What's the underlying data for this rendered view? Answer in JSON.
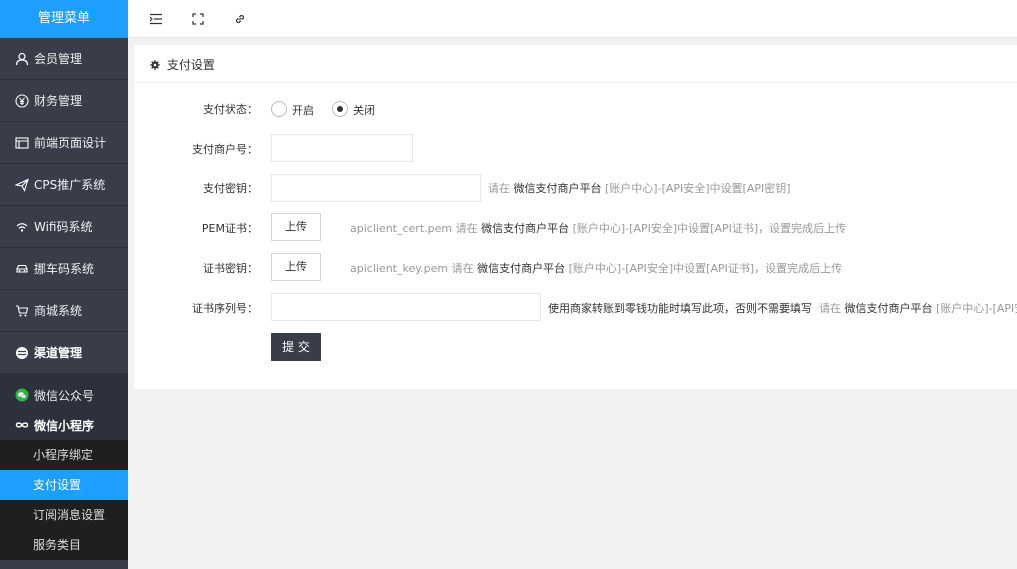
{
  "sidebar": {
    "header": "管理菜单",
    "items": [
      {
        "label": "会员管理",
        "icon": "user-icon"
      },
      {
        "label": "财务管理",
        "icon": "yen-icon"
      },
      {
        "label": "前端页面设计",
        "icon": "layout-icon"
      },
      {
        "label": "CPS推广系统",
        "icon": "send-icon"
      },
      {
        "label": "Wifi码系统",
        "icon": "wifi-icon"
      },
      {
        "label": "挪车码系统",
        "icon": "car-icon"
      },
      {
        "label": "商城系统",
        "icon": "cart-icon"
      },
      {
        "label": "渠道管理",
        "icon": "channel-icon"
      }
    ],
    "group": [
      {
        "label": "微信公众号",
        "icon": "wechat-icon"
      },
      {
        "label": "微信小程序",
        "icon": "miniprogram-icon"
      }
    ],
    "sub_items": [
      {
        "label": "小程序绑定"
      },
      {
        "label": "支付设置"
      },
      {
        "label": "订阅消息设置"
      },
      {
        "label": "服务类目"
      }
    ],
    "active_sub": "支付设置"
  },
  "toolbar": {
    "icons": [
      "menu-toggle-icon",
      "fullscreen-icon",
      "link-icon"
    ]
  },
  "panel": {
    "title": "支付设置",
    "form": {
      "status_label": "支付状态：",
      "status_options": [
        "开启",
        "关闭"
      ],
      "status_selected": "关闭",
      "merchant_label": "支付商户号：",
      "merchant_value": "",
      "key_label": "支付密钥：",
      "key_value": "",
      "key_hint_pre": "请在",
      "key_hint_platform": "微信支付商户平台",
      "key_hint_post": "[账户中心]-[API安全]中设置[API密钥]",
      "pem_label": "PEM证书：",
      "pem_button": "上传",
      "pem_file": "apiclient_cert.pem",
      "pem_hint_pre": "请在",
      "pem_hint_platform": "微信支付商户平台",
      "pem_hint_post": "[账户中心]-[API安全]中设置[API证书]，设置完成后上传",
      "certkey_label": "证书密钥：",
      "certkey_button": "上传",
      "certkey_file": "apiclient_key.pem",
      "certkey_hint_pre": "请在",
      "certkey_hint_platform": "微信支付商户平台",
      "certkey_hint_post": "[账户中心]-[API安全]中设置[API证书]，设置完成后上传",
      "serial_label": "证书序列号：",
      "serial_value": "",
      "serial_hint_dark": "使用商家转账到零钱功能时填写此项，否则不需要填写",
      "serial_hint_pre": "请在",
      "serial_hint_platform": "微信支付商户平台",
      "serial_hint_post": "[账户中心]-[API安全]-",
      "submit": "提 交"
    }
  }
}
